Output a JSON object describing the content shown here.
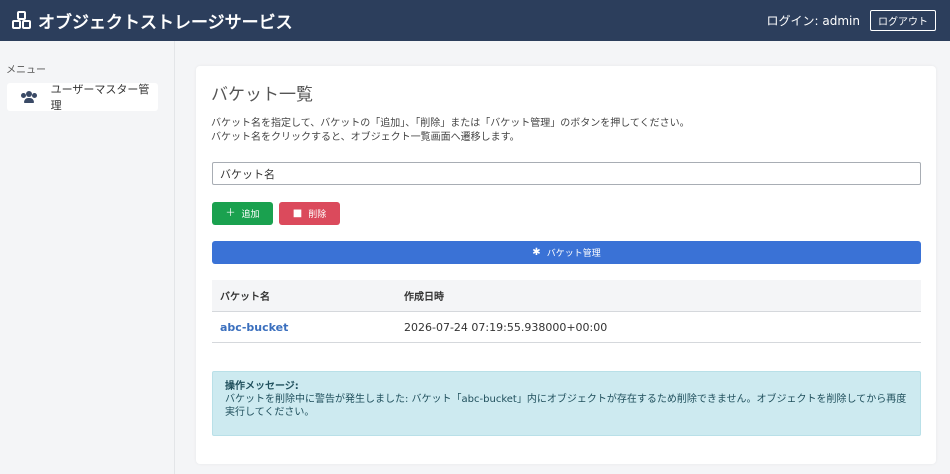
{
  "header": {
    "app_title": "オブジェクトストレージサービス",
    "login_text": "ログイン: admin",
    "logout_label": "ログアウト"
  },
  "sidebar": {
    "menu_title": "メニュー",
    "items": [
      {
        "label": "ユーザーマスター管理",
        "icon": "users-icon"
      }
    ]
  },
  "main": {
    "title": "バケット一覧",
    "description_line1": "バケット名を指定して、バケットの「追加」、「削除」または「バケット管理」のボタンを押してください。",
    "description_line2": "バケット名をクリックすると、オブジェクト一覧画面へ遷移します。",
    "bucket_input": {
      "value": "バケット名",
      "placeholder": ""
    },
    "add_label": "追加",
    "delete_label": "削除",
    "manage_label": "バケット管理",
    "table": {
      "headers": [
        "バケット名",
        "作成日時"
      ],
      "rows": [
        {
          "name": "abc-bucket",
          "created": "2026-07-24 07:19:55.938000+00:00"
        }
      ]
    },
    "alert": {
      "title": "操作メッセージ:",
      "message": "バケットを削除中に警告が発生しました: バケット「abc-bucket」内にオブジェクトが存在するため削除できません。オブジェクトを削除してから再度実行してください。"
    }
  },
  "colors": {
    "header_bg": "#2c3e5c",
    "add_button": "#1aa14f",
    "delete_button": "#db4a5c",
    "manage_button": "#3a72d6",
    "alert_bg": "#cdeaf0",
    "link": "#3a6fbe"
  }
}
